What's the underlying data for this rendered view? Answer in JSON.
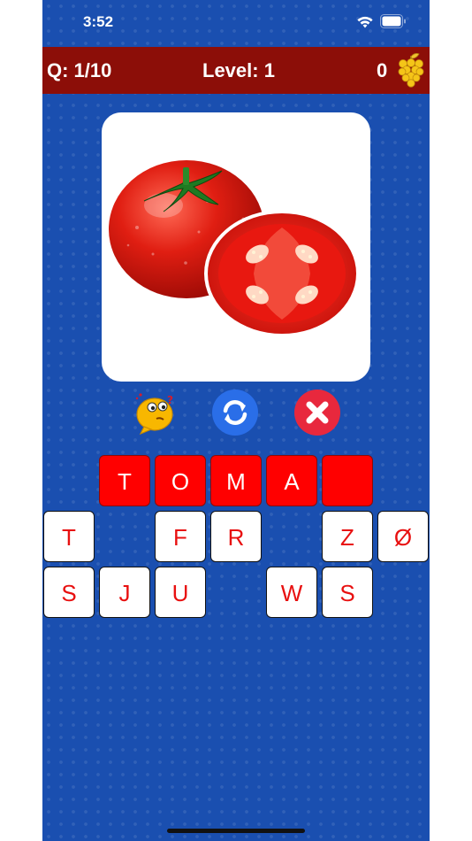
{
  "status_bar": {
    "time": "3:52"
  },
  "header": {
    "question_counter": "Q: 1/10",
    "level": "Level: 1",
    "coins": "0",
    "coin_icon": "grapes-icon"
  },
  "puzzle": {
    "image_subject": "tomato",
    "answer_slots": [
      "T",
      "O",
      "M",
      "A",
      ""
    ]
  },
  "actions": {
    "hint_icon": "thinking-emoji-icon",
    "refresh_icon": "refresh-icon",
    "remove_icon": "close-icon"
  },
  "letters": {
    "row1": [
      "T",
      "",
      "F",
      "R",
      "",
      "Z",
      "Ø"
    ],
    "row2": [
      "S",
      "J",
      "U",
      "",
      "W",
      "S",
      ""
    ]
  },
  "colors": {
    "background": "#1a4fb0",
    "topbar": "#8c0e08",
    "answer_tile": "#ff0000",
    "letter_text": "#e81010",
    "refresh": "#2a6ee8",
    "remove": "#e8283d"
  }
}
